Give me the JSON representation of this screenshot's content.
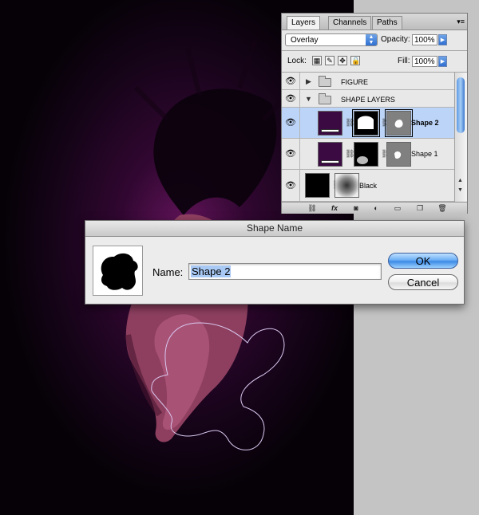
{
  "layers_panel": {
    "tabs": [
      {
        "label": "Layers",
        "active": true
      },
      {
        "label": "Channels",
        "active": false
      },
      {
        "label": "Paths",
        "active": false
      }
    ],
    "blend_mode": "Overlay",
    "opacity_label": "Opacity:",
    "opacity_value": "100%",
    "lock_label": "Lock:",
    "fill_label": "Fill:",
    "fill_value": "100%",
    "layers": [
      {
        "name": "FIGURE",
        "type": "group",
        "expanded": false,
        "visible": true
      },
      {
        "name": "SHAPE LAYERS",
        "type": "group",
        "expanded": true,
        "visible": true
      },
      {
        "name": "Shape 2",
        "type": "shape",
        "selected": true,
        "visible": true
      },
      {
        "name": "Shape 1",
        "type": "shape",
        "selected": false,
        "visible": true
      },
      {
        "name": "Black",
        "type": "fill",
        "selected": false,
        "visible": true
      }
    ],
    "bottom_icons": [
      "link-layers-icon",
      "fx-icon",
      "mask-icon",
      "adjustment-icon",
      "group-icon",
      "new-layer-icon",
      "trash-icon"
    ],
    "fx_label": "fx"
  },
  "dialog": {
    "title": "Shape Name",
    "name_label": "Name:",
    "name_value": "Shape 2",
    "ok_label": "OK",
    "cancel_label": "Cancel"
  },
  "colors": {
    "canvas_purple": "#6a1466",
    "selection_blue": "#bcd4f7",
    "aqua_button": "#3c8ae6"
  }
}
